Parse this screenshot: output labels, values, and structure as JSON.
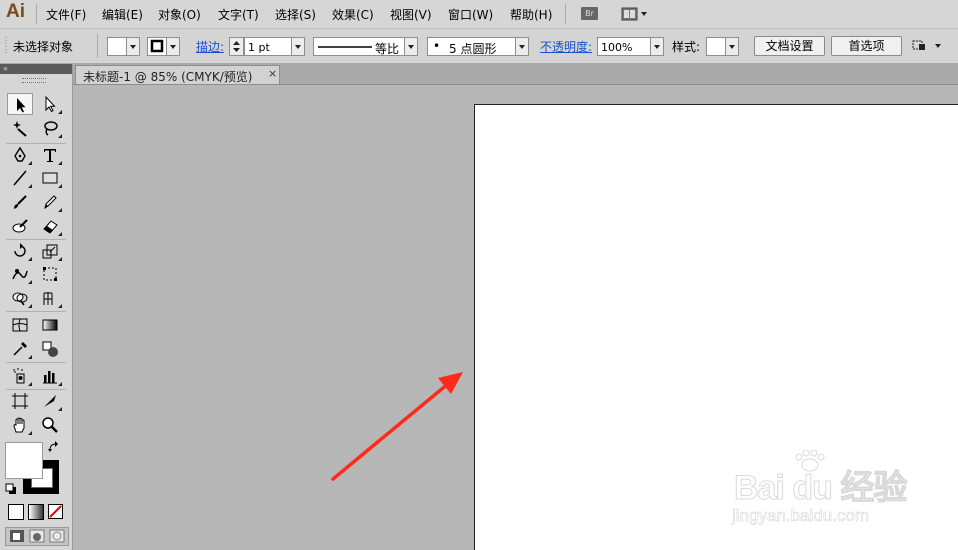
{
  "app": {
    "logo": "Ai",
    "bridge_label": "Br"
  },
  "menu": [
    {
      "label": "文件(F)"
    },
    {
      "label": "编辑(E)"
    },
    {
      "label": "对象(O)"
    },
    {
      "label": "文字(T)"
    },
    {
      "label": "选择(S)"
    },
    {
      "label": "效果(C)"
    },
    {
      "label": "视图(V)"
    },
    {
      "label": "窗口(W)"
    },
    {
      "label": "帮助(H)"
    }
  ],
  "control_bar": {
    "selection_status": "未选择对象",
    "stroke_label": "描边:",
    "stroke_weight": "1 pt",
    "stroke_profile": "等比",
    "brush": "5 点圆形",
    "brush_bullet": "•",
    "opacity_label": "不透明度:",
    "opacity_value": "100%",
    "style_label": "样式:",
    "doc_setup_button": "文档设置",
    "preferences_button": "首选项"
  },
  "tools_panel": {
    "collapse_glyph": "«"
  },
  "document": {
    "tab_title": "未标题-1 @ 85% (CMYK/预览)",
    "close_glyph": "×"
  },
  "watermark": {
    "brand": "Bai du 经验",
    "url": "jingyan.baidu.com"
  },
  "colors": {
    "annotation_arrow": "#ff2a1a",
    "logo": "#7a4a1a",
    "link": "#1a4fd0"
  }
}
